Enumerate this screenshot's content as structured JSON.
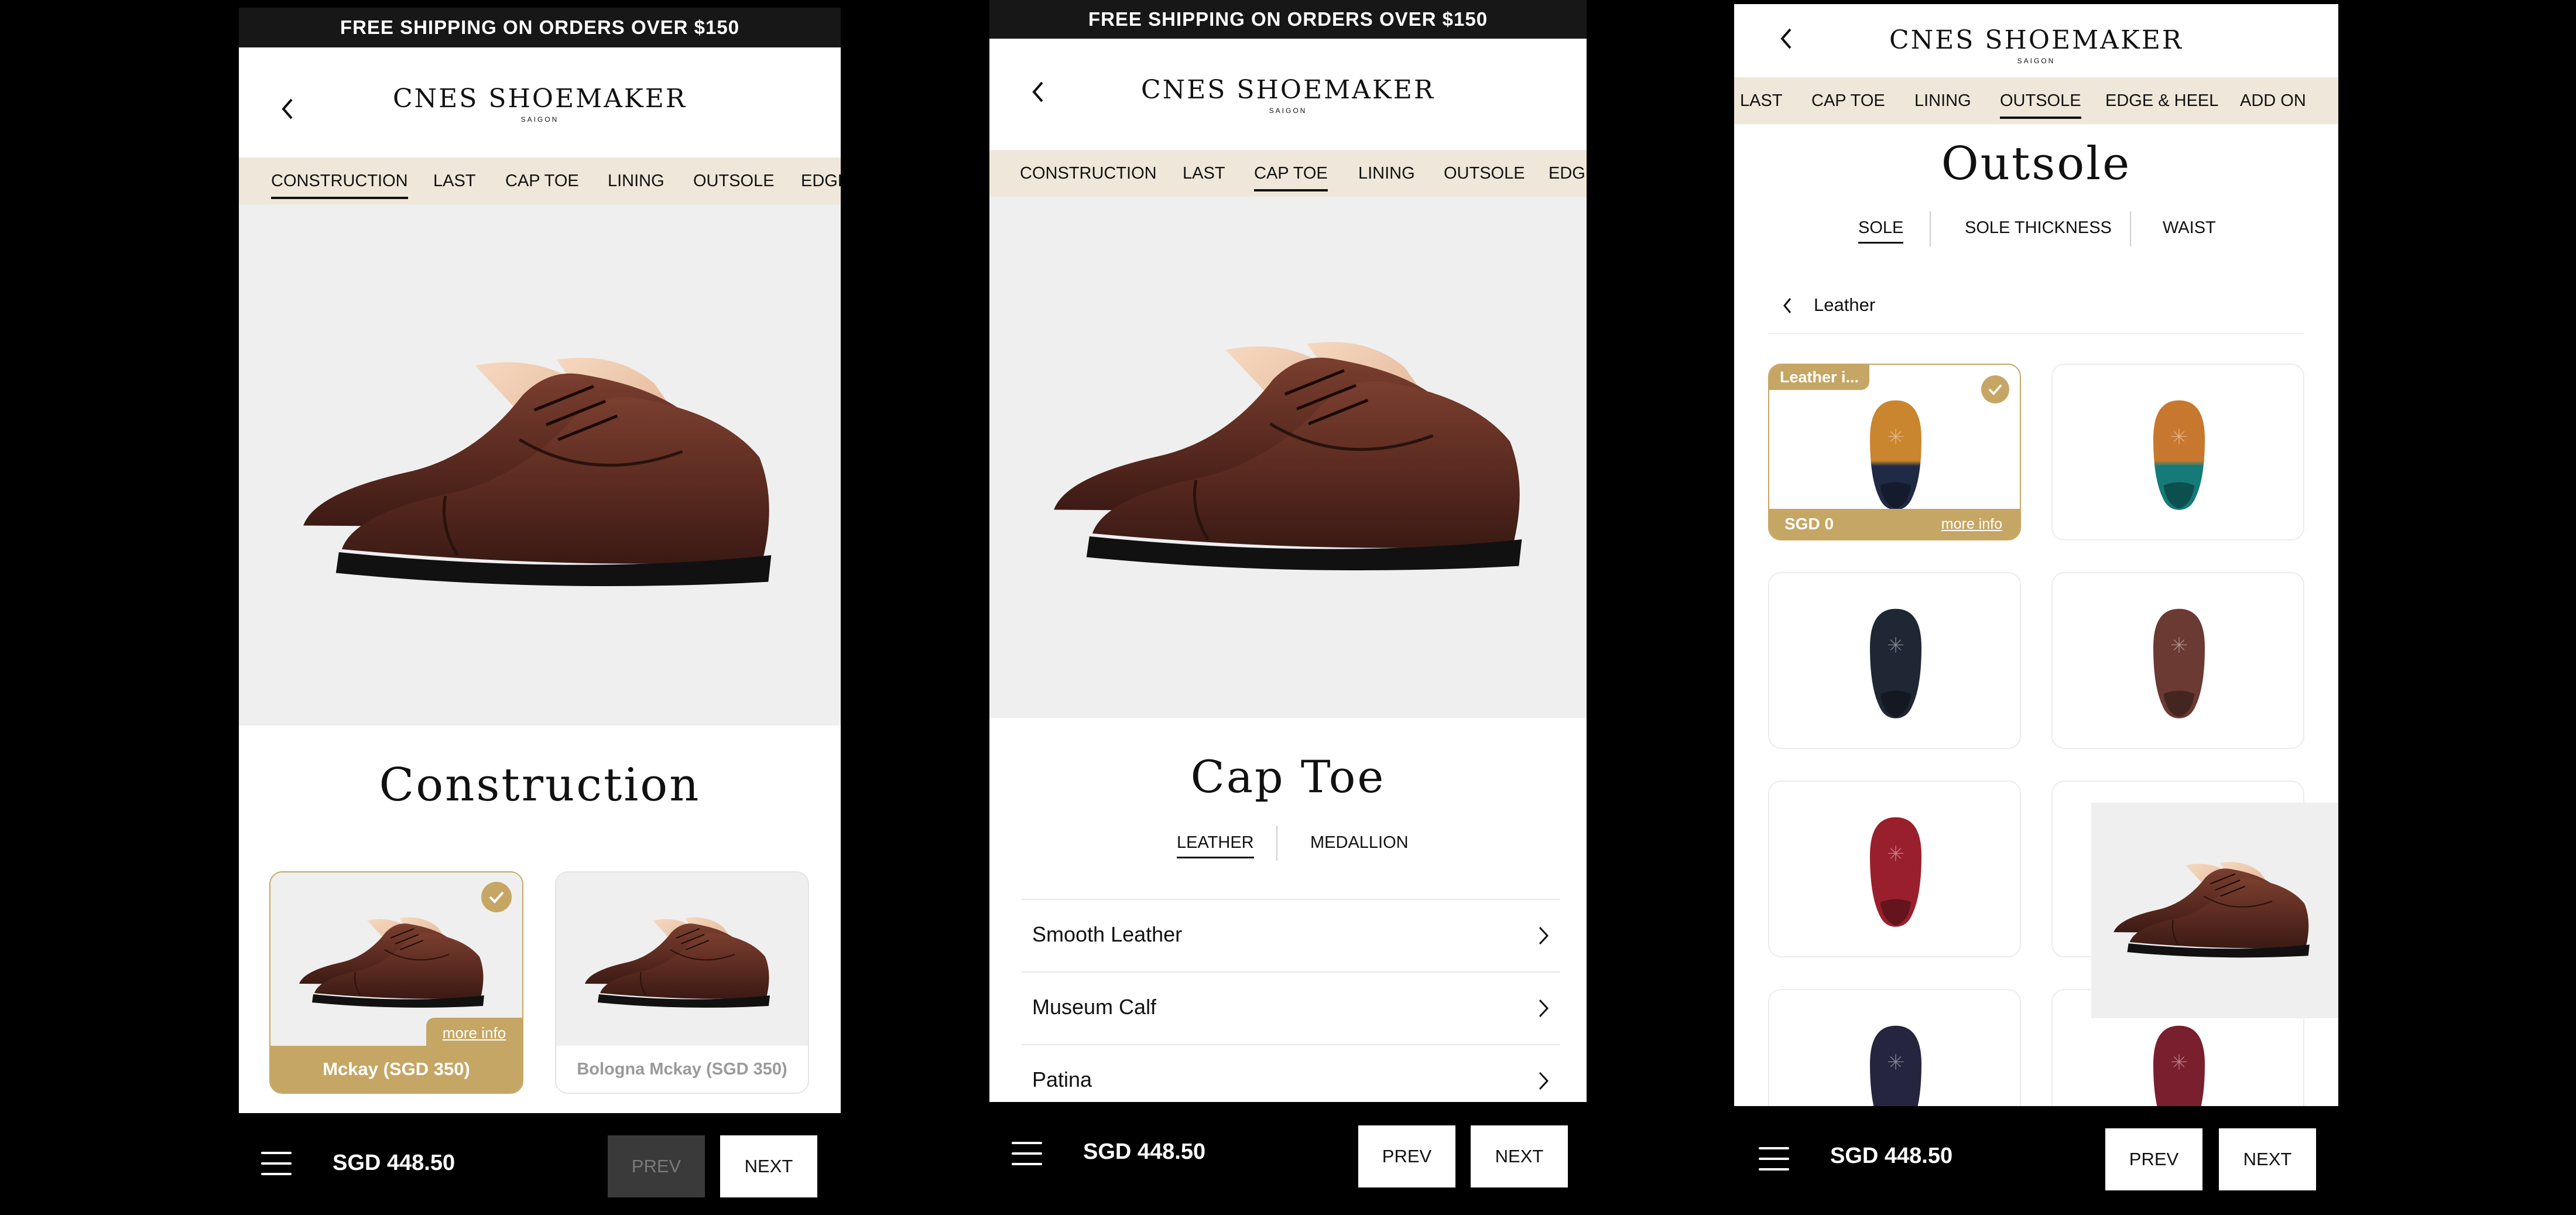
{
  "colors": {
    "accent_gold": "#c6a664",
    "nav_bg": "#efe7d9",
    "hero_bg": "#efefef",
    "banner_bg": "#171717",
    "footer_bg": "#000000"
  },
  "shared": {
    "shipping_banner": "FREE SHIPPING ON ORDERS OVER $150",
    "brand_name": "CNES SHOEMAKER",
    "brand_sub": "SAIGON",
    "price": "SGD 448.50",
    "prev_label": "PREV",
    "next_label": "NEXT"
  },
  "screen1": {
    "tabs": [
      "CONSTRUCTION",
      "LAST",
      "CAP TOE",
      "LINING",
      "OUTSOLE",
      "EDGE"
    ],
    "active_tab": "CONSTRUCTION",
    "title": "Construction",
    "options": [
      {
        "label": "Mckay (SGD 350)",
        "more_info": "more info",
        "selected": true
      },
      {
        "label": "Bologna Mckay (SGD 350)",
        "selected": false
      }
    ],
    "prev_disabled": true
  },
  "screen2": {
    "tabs": [
      "CONSTRUCTION",
      "LAST",
      "CAP TOE",
      "LINING",
      "OUTSOLE",
      "EDG"
    ],
    "active_tab": "CAP TOE",
    "title": "Cap Toe",
    "subtabs": [
      "LEATHER",
      "MEDALLION"
    ],
    "active_subtab": "LEATHER",
    "rows": [
      "Smooth Leather",
      "Museum Calf",
      "Patina"
    ]
  },
  "screen3": {
    "tabs": [
      "LAST",
      "CAP TOE",
      "LINING",
      "OUTSOLE",
      "EDGE & HEEL",
      "ADD ON"
    ],
    "active_tab": "OUTSOLE",
    "title": "Outsole",
    "subtabs": [
      "SOLE",
      "SOLE THICKNESS",
      "WAIST"
    ],
    "active_subtab": "SOLE",
    "breadcrumb": "Leather",
    "selected_sole": {
      "badge": "Leather i...",
      "price": "SGD 0",
      "more_info": "more info"
    },
    "soles": [
      {
        "colors": [
          "#c9862e",
          "#1f2a44"
        ],
        "selected": true
      },
      {
        "colors": [
          "#c7782e",
          "#157a78"
        ],
        "selected": false
      },
      {
        "colors": [
          "#1f2734",
          "#1f2734"
        ],
        "selected": false
      },
      {
        "colors": [
          "#6b3a32",
          "#6b3a32"
        ],
        "selected": false
      },
      {
        "colors": [
          "#9a1f2c",
          "#9a1f2c"
        ],
        "selected": false
      },
      {
        "colors": [
          "#d6a65a",
          "#d6a65a"
        ],
        "selected": false
      },
      {
        "colors": [
          "#26253f",
          "#26253f"
        ],
        "selected": false
      },
      {
        "colors": [
          "#7a1f2e",
          "#7a1f2e"
        ],
        "selected": false
      }
    ]
  }
}
